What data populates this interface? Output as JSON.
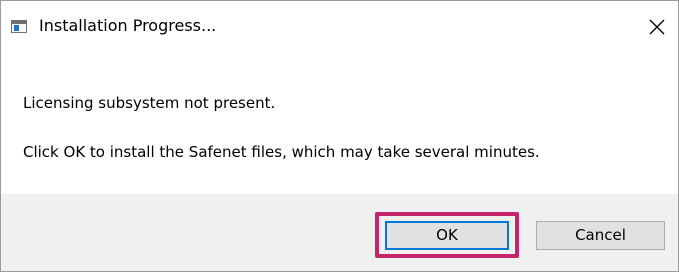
{
  "window": {
    "title": "Installation Progress...",
    "close_icon": "close-icon"
  },
  "message": {
    "line1": "Licensing subsystem not present.",
    "line2": "Click OK to install the Safenet files, which may take several minutes."
  },
  "buttons": {
    "ok_label": "OK",
    "cancel_label": "Cancel"
  },
  "colors": {
    "highlight_frame": "#c7246d",
    "default_button_border": "#0078d7",
    "footer_background": "#f0f0f0"
  }
}
